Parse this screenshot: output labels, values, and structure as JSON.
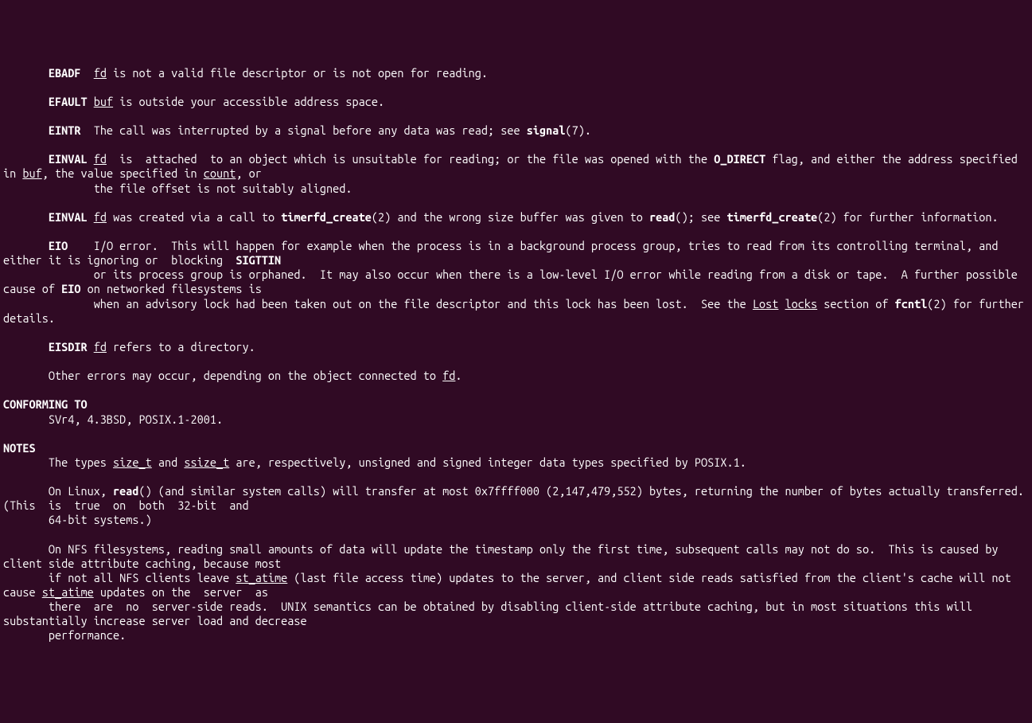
{
  "errors": {
    "ebadf": {
      "code": "EBADF",
      "arg": "fd",
      "text": " is not a valid file descriptor or is not open for reading."
    },
    "efault": {
      "code": "EFAULT",
      "arg": "buf",
      "text": " is outside your accessible address space."
    },
    "eintr": {
      "code": "EINTR",
      "text1": "  The call was interrupted by a signal before any data was read; see ",
      "ref": "signal",
      "text2": "(7)."
    },
    "einval1": {
      "code": "EINVAL",
      "arg": "fd",
      "text1": "  is  attached  to an object which is unsuitable for reading; or the file was opened with the ",
      "flag": "O_DIRECT",
      "text2": " flag, and either the address specified in ",
      "arg2": "buf",
      "text3": ", the value specified in ",
      "arg3": "count",
      "text4": ", or",
      "cont": "              the file offset is not suitably aligned."
    },
    "einval2": {
      "code": "EINVAL",
      "arg": "fd",
      "text1": " was created via a call to ",
      "ref1": "timerfd_create",
      "text2": "(2) and the wrong size buffer was given to ",
      "ref2": "read",
      "text3": "(); see ",
      "ref3": "timerfd_create",
      "text4": "(2) for further information."
    },
    "eio": {
      "code": "EIO",
      "text1": "    I/O error.  This will happen for example when the process is in a background process group, tries to read from its controlling terminal, and either it is ignoring or  blocking  ",
      "sig": "SIGTTIN",
      "cont1": "              or its process group is orphaned.  It may also occur when there is a low-level I/O error while reading from a disk or tape.  A further possible cause of ",
      "ref1": "EIO",
      "text2": " on networked filesystems is",
      "cont2": "              when an advisory lock had been taken out on the file descriptor and this lock has been lost.  See the ",
      "u1": "Lost",
      "u2": "locks",
      "text3": " section of ",
      "ref2": "fcntl",
      "text4": "(2) for further details."
    },
    "eisdir": {
      "code": "EISDIR",
      "arg": "fd",
      "text": " refers to a directory."
    },
    "other": {
      "text1": "       Other errors may occur, depending on the object connected to ",
      "arg": "fd",
      "text2": "."
    }
  },
  "conforming": {
    "header": "CONFORMING TO",
    "body": "       SVr4, 4.3BSD, POSIX.1-2001."
  },
  "notes": {
    "header": "NOTES",
    "p1": {
      "t1": "       The types ",
      "u1": "size_t",
      "t2": " and ",
      "u2": "ssize_t",
      "t3": " are, respectively, unsigned and signed integer data types specified by POSIX.1."
    },
    "p2": {
      "t1": "       On Linux, ",
      "b1": "read",
      "t2": "() (and similar system calls) will transfer at most 0x7ffff000 (2,147,479,552) bytes, returning the number of bytes actually transferred.  (This  is  true  on  both  32-bit  and",
      "cont": "       64-bit systems.)"
    },
    "p3": {
      "t1": "       On NFS filesystems, reading small amounts of data will update the timestamp only the first time, subsequent calls may not do so.  This is caused by client side attribute caching, because most",
      "t2": "       if not all NFS clients leave ",
      "u1": "st_atime",
      "t3": " (last file access time) updates to the server, and client side reads satisfied from the client's cache will not cause ",
      "u2": "st_atime",
      "t4": " updates on the  server  as",
      "t5": "       there  are  no  server-side reads.  UNIX semantics can be obtained by disabling client-side attribute caching, but in most situations this will substantially increase server load and decrease",
      "t6": "       performance."
    }
  }
}
